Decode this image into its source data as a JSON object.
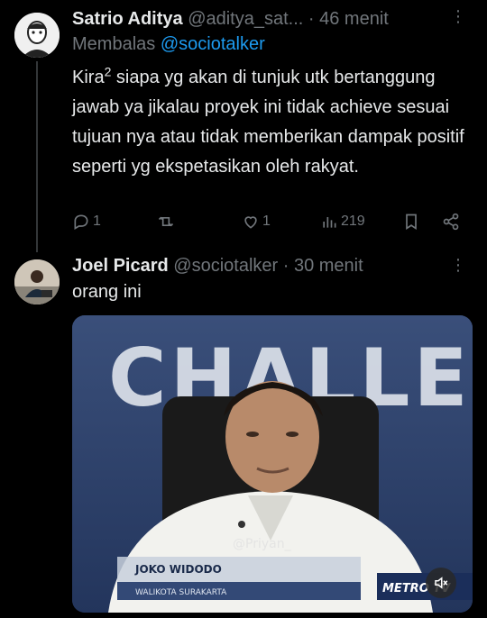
{
  "tweets": [
    {
      "name": "Satrio Aditya",
      "handle": "@aditya_sat...",
      "time": "· 46 menit",
      "reply_prefix": "Membalas",
      "reply_handle": "@sociotalker",
      "text_before_sup": "Kira",
      "text_sup": "2",
      "text_after_sup": " siapa yg akan di tunjuk utk bertanggung jawab ya jikalau proyek ini tidak achieve sesuai tujuan nya atau tidak memberikan dampak positif seperti yg ekspetasikan oleh rakyat.",
      "replies": "1",
      "likes": "1",
      "views": "219"
    },
    {
      "name": "Joel Picard",
      "handle": "@sociotalker",
      "time": "· 30 menit",
      "text": "orang ini",
      "video": {
        "backdrop_text": "CHALLE",
        "watermark": "@Priyan_",
        "caption_name": "JOKO WIDODO",
        "caption_title": "WALIKOTA SURAKARTA",
        "channel_logo": "METRO TV"
      }
    }
  ],
  "colors": {
    "background": "#000000",
    "text": "#e7e9ea",
    "muted": "#71767b",
    "link": "#1d9bf0"
  },
  "icons": [
    "reply-icon",
    "retweet-icon",
    "like-icon",
    "views-icon",
    "bookmark-icon",
    "share-icon",
    "more-icon",
    "mute-icon"
  ]
}
